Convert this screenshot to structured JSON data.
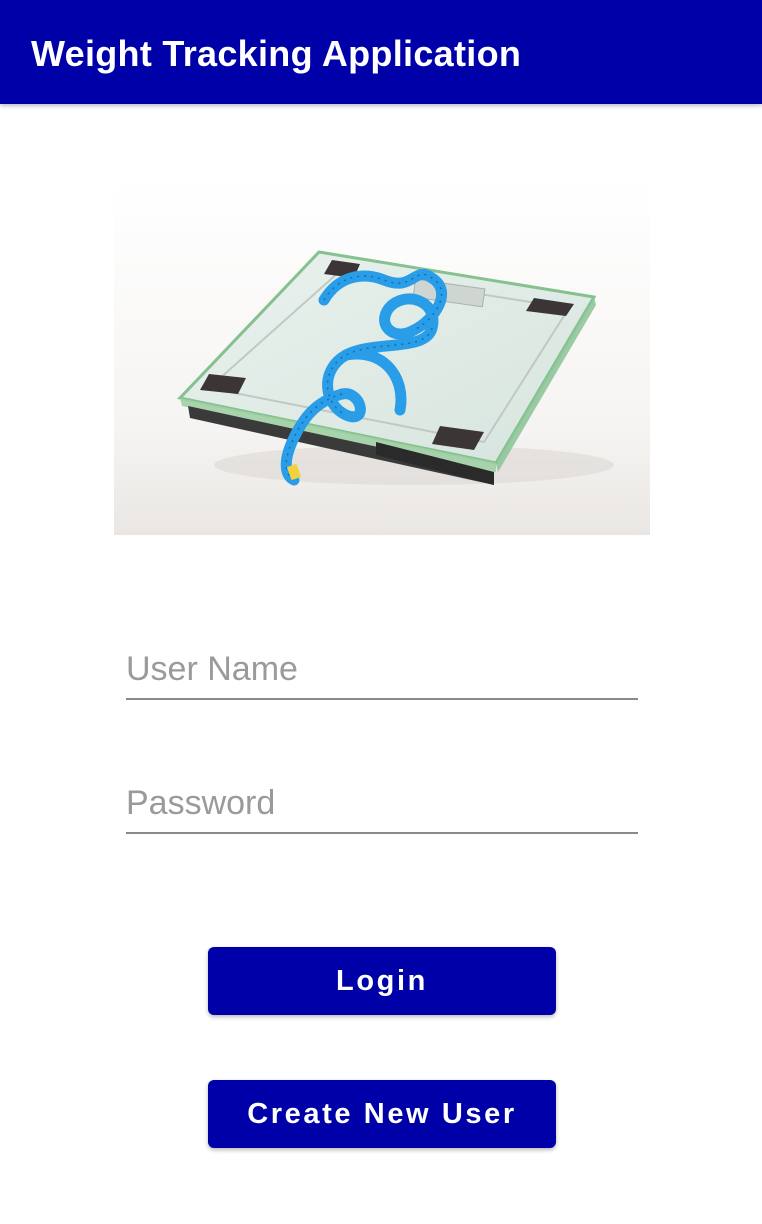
{
  "app_bar": {
    "title": "Weight Tracking Application",
    "color": "#0000A8"
  },
  "hero_image": {
    "name": "scale-with-measuring-tape-image"
  },
  "form": {
    "username_placeholder": "User Name",
    "username_value": "",
    "password_placeholder": "Password",
    "password_value": ""
  },
  "buttons": {
    "login_label": "Login",
    "create_user_label": "Create New User",
    "color": "#0000A8"
  }
}
